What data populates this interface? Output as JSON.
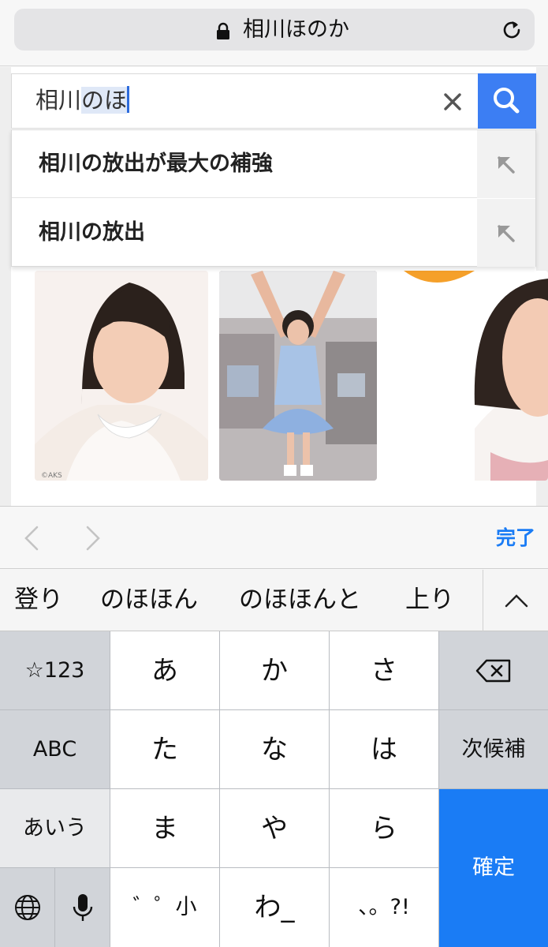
{
  "address_bar": {
    "title": "相川ほのか"
  },
  "search": {
    "typed_prefix": "相川",
    "typed_selected": "のほ"
  },
  "suggestions": [
    {
      "text": "相川の放出が最大の補強"
    },
    {
      "text": "相川の放出"
    }
  ],
  "thumbnails": {
    "watermark": "©AKS"
  },
  "keyboard_toolbar": {
    "done_label": "完了"
  },
  "candidates": [
    "登り",
    "のほほん",
    "のほほんと",
    "上り"
  ],
  "keyboard": {
    "keys": {
      "symbols": "☆123",
      "a": "あ",
      "ka": "か",
      "sa": "さ",
      "abc": "ABC",
      "ta": "た",
      "na": "な",
      "ha": "は",
      "next_candidate": "次候補",
      "aiu": "あいう",
      "ma": "ま",
      "ya": "や",
      "ra": "ら",
      "confirm": "確定",
      "dakuten": "゛゜小",
      "wa": "わ_",
      "punct": "、。?!"
    }
  },
  "colors": {
    "accent": "#3c7ef3",
    "confirm_key": "#1a7cf5",
    "done_text": "#1a7cf5"
  }
}
